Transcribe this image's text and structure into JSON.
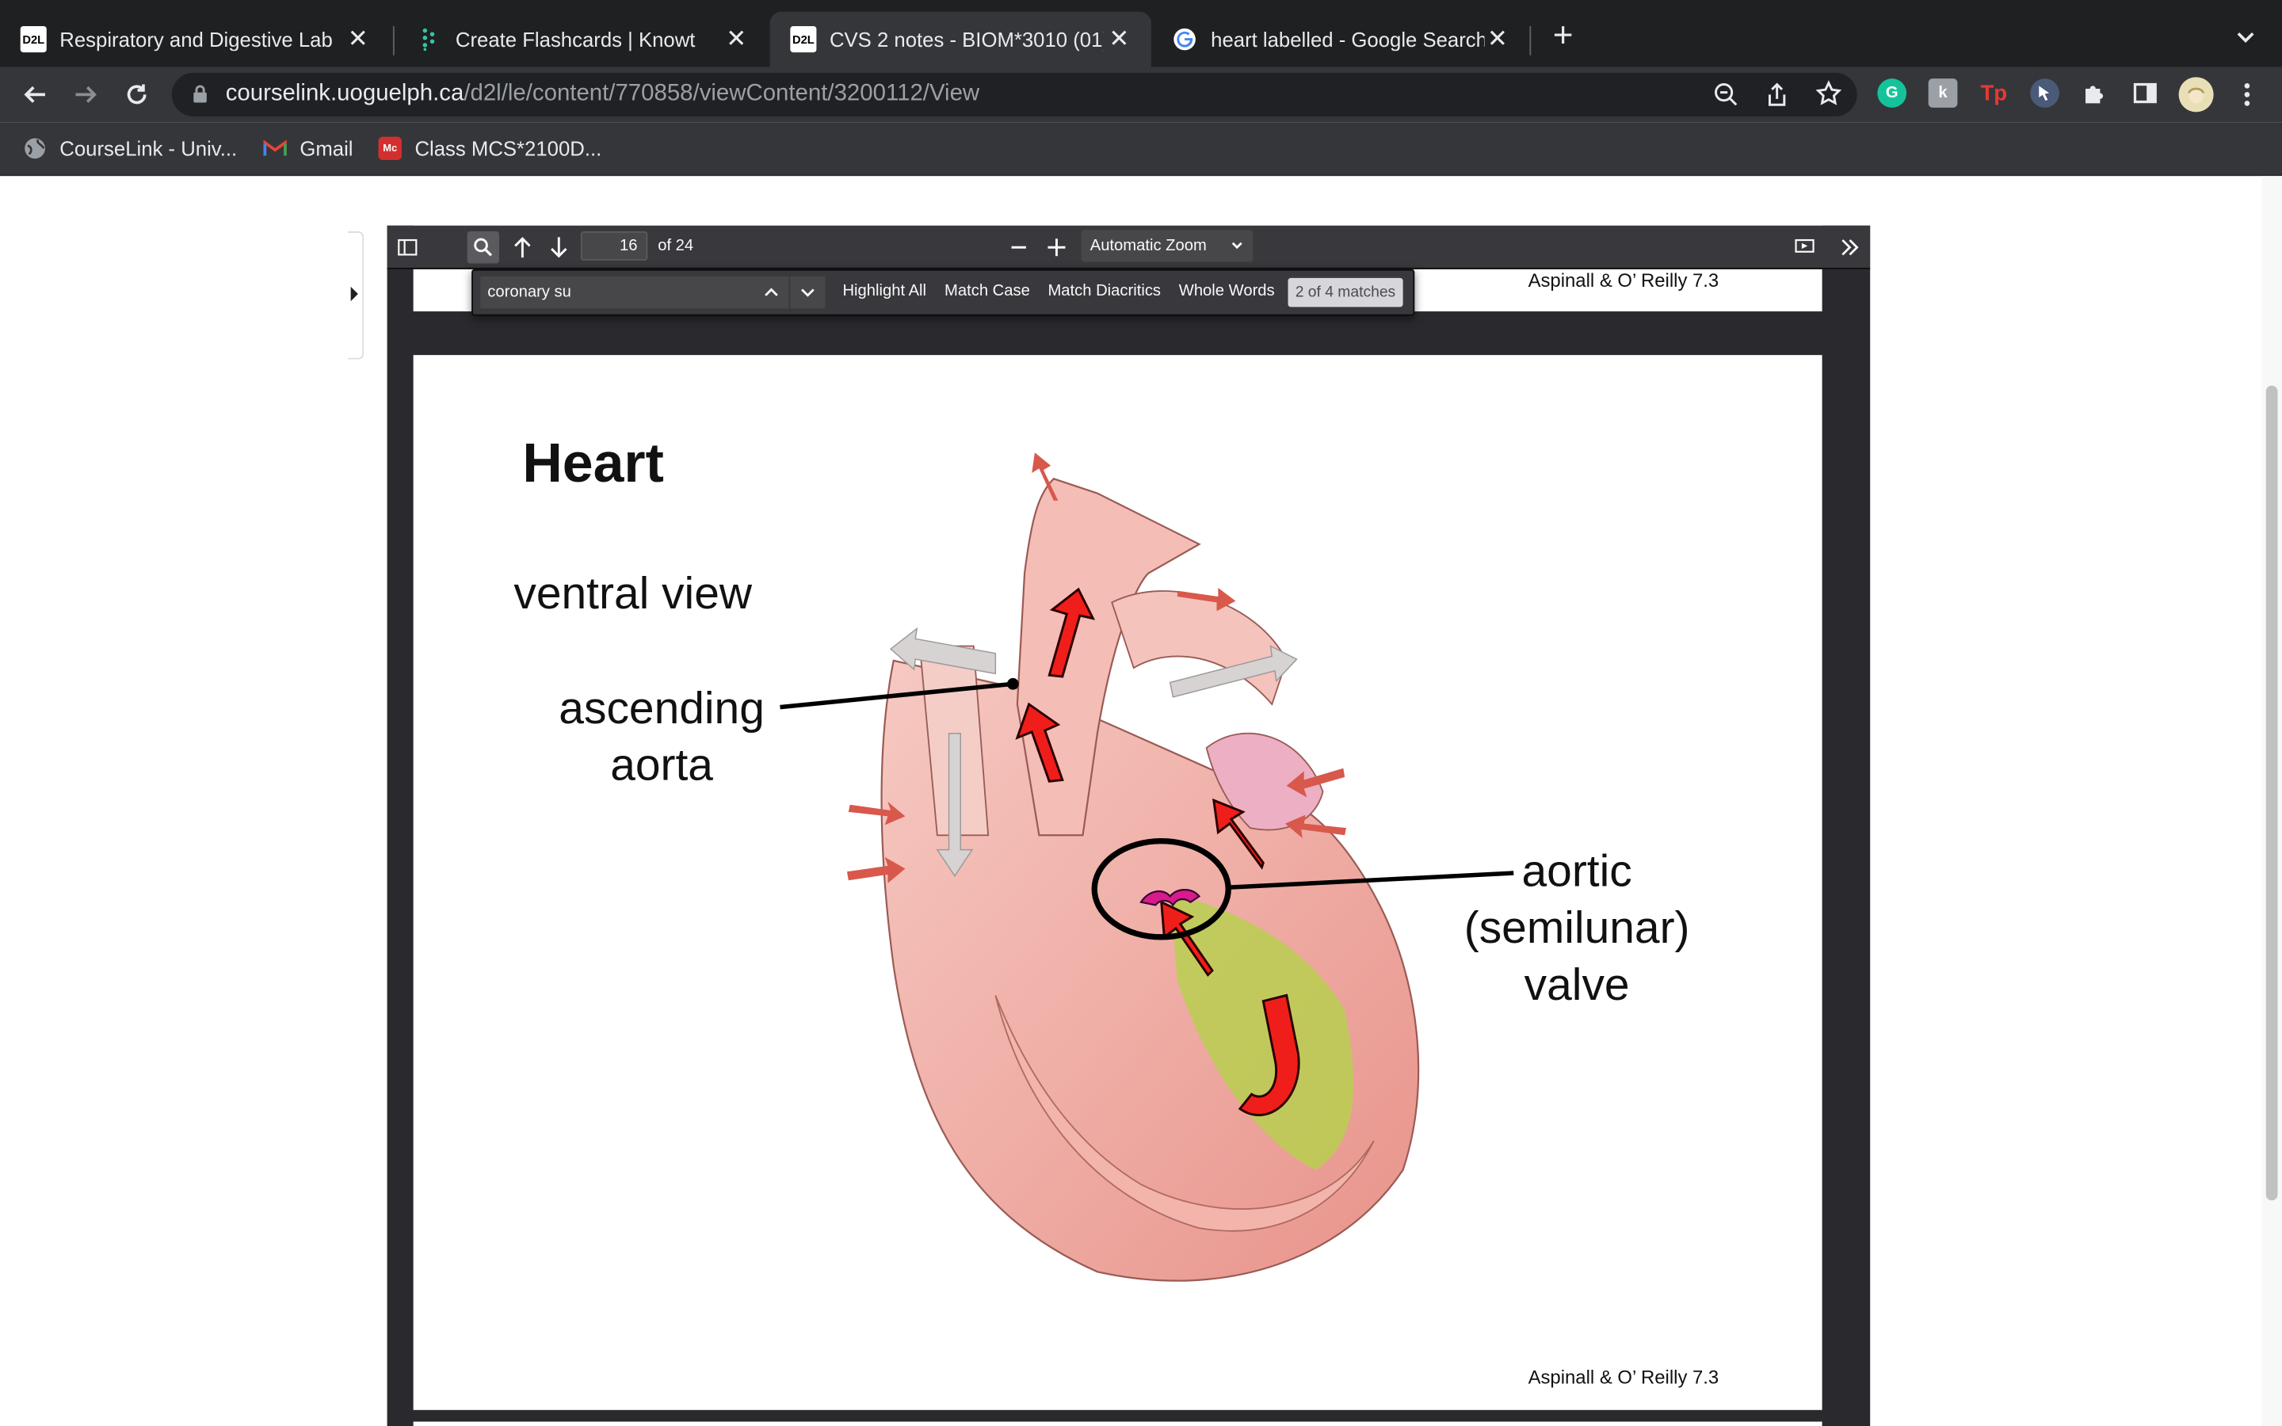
{
  "browser": {
    "tabs": [
      {
        "title": "Respiratory and Digestive Lab",
        "favicon": "D2L",
        "active": false
      },
      {
        "title": "Create Flashcards | Knowt",
        "favicon": "knowt",
        "active": false
      },
      {
        "title": "CVS 2 notes - BIOM*3010 (01)",
        "favicon": "D2L",
        "active": true
      },
      {
        "title": "heart labelled - Google Search",
        "favicon": "G",
        "active": false
      }
    ],
    "url_host": "courselink.uoguelph.ca",
    "url_path": "/d2l/le/content/770858/viewContent/3200112/View",
    "bookmarks": [
      {
        "label": "CourseLink - Univ...",
        "icon": "globe-icon"
      },
      {
        "label": "Gmail",
        "icon": "gmail-icon"
      },
      {
        "label": "Class MCS*2100D...",
        "icon": "mcgraw-hill-icon"
      }
    ]
  },
  "pdf_viewer": {
    "page_number": "16",
    "page_count": "of 24",
    "zoom": "Automatic Zoom",
    "find": {
      "query": "coronary su",
      "options": [
        "Highlight All",
        "Match Case",
        "Match Diacritics",
        "Whole Words"
      ],
      "result": "2 of 4 matches"
    }
  },
  "slide": {
    "prev_citation": "Aspinall & O’ Reilly 7.3",
    "title": "Heart",
    "subtitle": "ventral view",
    "label_left_line1": "ascending",
    "label_left_line2": "aorta",
    "label_right_line1": "aortic",
    "label_right_line2": "(semilunar)",
    "label_right_line3": "valve",
    "citation": "Aspinall & O’ Reilly 7.3"
  },
  "colors": {
    "tab_strip": "#1f2022",
    "toolbar": "#35363a",
    "pdf_toolbar": "#38383d",
    "flow_arrow": "#e8201c",
    "valve_highlight": "#d81b8c",
    "ventricle_highlight": "#b9cf50"
  }
}
